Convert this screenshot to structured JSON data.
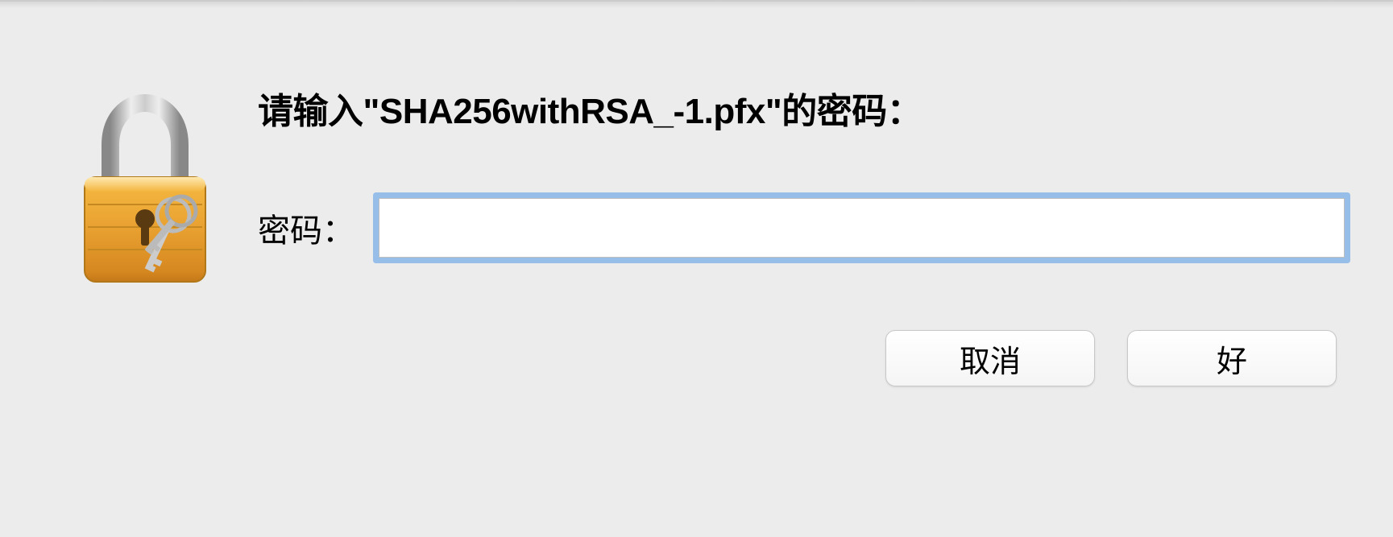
{
  "dialog": {
    "prompt": "请输入\"SHA256withRSA_-1.pfx\"的密码：",
    "password_label": "密码：",
    "password_value": "",
    "cancel_label": "取消",
    "ok_label": "好"
  }
}
